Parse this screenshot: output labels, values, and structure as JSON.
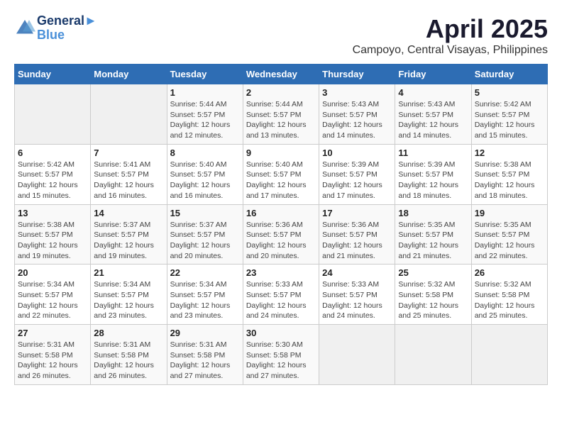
{
  "header": {
    "logo_line1": "General",
    "logo_line2": "Blue",
    "month": "April 2025",
    "location": "Campoyo, Central Visayas, Philippines"
  },
  "weekdays": [
    "Sunday",
    "Monday",
    "Tuesday",
    "Wednesday",
    "Thursday",
    "Friday",
    "Saturday"
  ],
  "weeks": [
    [
      {
        "day": "",
        "detail": ""
      },
      {
        "day": "",
        "detail": ""
      },
      {
        "day": "1",
        "detail": "Sunrise: 5:44 AM\nSunset: 5:57 PM\nDaylight: 12 hours and 12 minutes."
      },
      {
        "day": "2",
        "detail": "Sunrise: 5:44 AM\nSunset: 5:57 PM\nDaylight: 12 hours and 13 minutes."
      },
      {
        "day": "3",
        "detail": "Sunrise: 5:43 AM\nSunset: 5:57 PM\nDaylight: 12 hours and 14 minutes."
      },
      {
        "day": "4",
        "detail": "Sunrise: 5:43 AM\nSunset: 5:57 PM\nDaylight: 12 hours and 14 minutes."
      },
      {
        "day": "5",
        "detail": "Sunrise: 5:42 AM\nSunset: 5:57 PM\nDaylight: 12 hours and 15 minutes."
      }
    ],
    [
      {
        "day": "6",
        "detail": "Sunrise: 5:42 AM\nSunset: 5:57 PM\nDaylight: 12 hours and 15 minutes."
      },
      {
        "day": "7",
        "detail": "Sunrise: 5:41 AM\nSunset: 5:57 PM\nDaylight: 12 hours and 16 minutes."
      },
      {
        "day": "8",
        "detail": "Sunrise: 5:40 AM\nSunset: 5:57 PM\nDaylight: 12 hours and 16 minutes."
      },
      {
        "day": "9",
        "detail": "Sunrise: 5:40 AM\nSunset: 5:57 PM\nDaylight: 12 hours and 17 minutes."
      },
      {
        "day": "10",
        "detail": "Sunrise: 5:39 AM\nSunset: 5:57 PM\nDaylight: 12 hours and 17 minutes."
      },
      {
        "day": "11",
        "detail": "Sunrise: 5:39 AM\nSunset: 5:57 PM\nDaylight: 12 hours and 18 minutes."
      },
      {
        "day": "12",
        "detail": "Sunrise: 5:38 AM\nSunset: 5:57 PM\nDaylight: 12 hours and 18 minutes."
      }
    ],
    [
      {
        "day": "13",
        "detail": "Sunrise: 5:38 AM\nSunset: 5:57 PM\nDaylight: 12 hours and 19 minutes."
      },
      {
        "day": "14",
        "detail": "Sunrise: 5:37 AM\nSunset: 5:57 PM\nDaylight: 12 hours and 19 minutes."
      },
      {
        "day": "15",
        "detail": "Sunrise: 5:37 AM\nSunset: 5:57 PM\nDaylight: 12 hours and 20 minutes."
      },
      {
        "day": "16",
        "detail": "Sunrise: 5:36 AM\nSunset: 5:57 PM\nDaylight: 12 hours and 20 minutes."
      },
      {
        "day": "17",
        "detail": "Sunrise: 5:36 AM\nSunset: 5:57 PM\nDaylight: 12 hours and 21 minutes."
      },
      {
        "day": "18",
        "detail": "Sunrise: 5:35 AM\nSunset: 5:57 PM\nDaylight: 12 hours and 21 minutes."
      },
      {
        "day": "19",
        "detail": "Sunrise: 5:35 AM\nSunset: 5:57 PM\nDaylight: 12 hours and 22 minutes."
      }
    ],
    [
      {
        "day": "20",
        "detail": "Sunrise: 5:34 AM\nSunset: 5:57 PM\nDaylight: 12 hours and 22 minutes."
      },
      {
        "day": "21",
        "detail": "Sunrise: 5:34 AM\nSunset: 5:57 PM\nDaylight: 12 hours and 23 minutes."
      },
      {
        "day": "22",
        "detail": "Sunrise: 5:34 AM\nSunset: 5:57 PM\nDaylight: 12 hours and 23 minutes."
      },
      {
        "day": "23",
        "detail": "Sunrise: 5:33 AM\nSunset: 5:57 PM\nDaylight: 12 hours and 24 minutes."
      },
      {
        "day": "24",
        "detail": "Sunrise: 5:33 AM\nSunset: 5:57 PM\nDaylight: 12 hours and 24 minutes."
      },
      {
        "day": "25",
        "detail": "Sunrise: 5:32 AM\nSunset: 5:58 PM\nDaylight: 12 hours and 25 minutes."
      },
      {
        "day": "26",
        "detail": "Sunrise: 5:32 AM\nSunset: 5:58 PM\nDaylight: 12 hours and 25 minutes."
      }
    ],
    [
      {
        "day": "27",
        "detail": "Sunrise: 5:31 AM\nSunset: 5:58 PM\nDaylight: 12 hours and 26 minutes."
      },
      {
        "day": "28",
        "detail": "Sunrise: 5:31 AM\nSunset: 5:58 PM\nDaylight: 12 hours and 26 minutes."
      },
      {
        "day": "29",
        "detail": "Sunrise: 5:31 AM\nSunset: 5:58 PM\nDaylight: 12 hours and 27 minutes."
      },
      {
        "day": "30",
        "detail": "Sunrise: 5:30 AM\nSunset: 5:58 PM\nDaylight: 12 hours and 27 minutes."
      },
      {
        "day": "",
        "detail": ""
      },
      {
        "day": "",
        "detail": ""
      },
      {
        "day": "",
        "detail": ""
      }
    ]
  ]
}
